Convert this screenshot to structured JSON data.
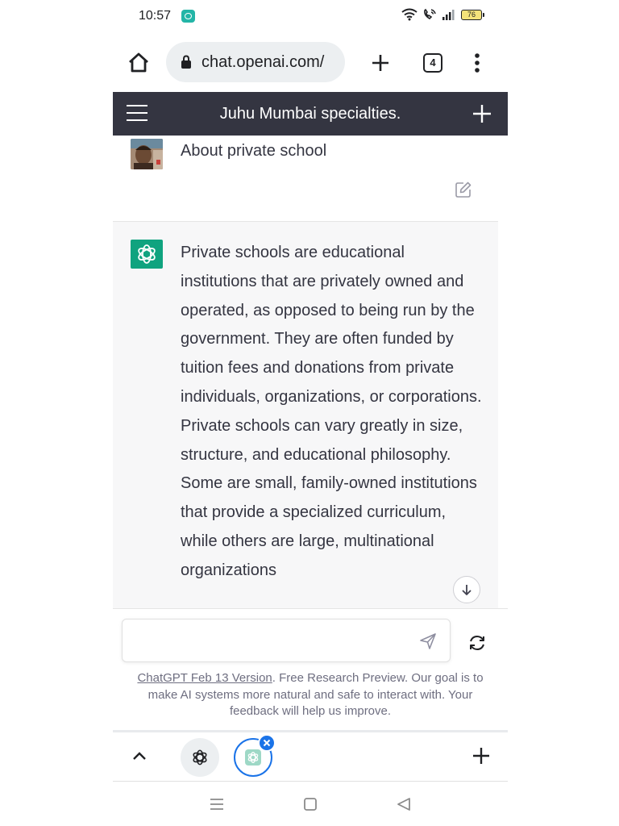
{
  "status_bar": {
    "time": "10:57",
    "battery": "76"
  },
  "browser": {
    "url": "chat.openai.com/",
    "tab_count": "4"
  },
  "chat": {
    "title": "Juhu Mumbai specialties.",
    "user_message": "About private school",
    "assistant_message": "Private schools are educational institutions that are privately owned and operated, as opposed to being run by the government. They are often funded by tuition fees and donations from private individuals, organizations, or corporations. Private schools can vary greatly in size, structure, and educational philosophy. Some are small, family-owned institutions that provide a specialized curriculum, while others are large, multinational organizations"
  },
  "composer": {
    "placeholder": "",
    "disclaimer_link": "ChatGPT Feb 13 Version",
    "disclaimer_text": ". Free Research Preview. Our goal is to make AI systems more natural and safe to interact with. Your feedback will help us improve."
  },
  "colors": {
    "header_bg": "#343541",
    "assistant_bg": "#f7f7f8",
    "brand_green": "#10a37f",
    "accent_blue": "#1a73e8"
  },
  "icons": {
    "home": "home-icon",
    "lock": "lock-icon",
    "new_tab": "plus-icon",
    "tabs": "tab-switcher-icon",
    "overflow": "more-vert-icon",
    "menu": "hamburger-menu-icon",
    "new_chat": "plus-icon",
    "edit": "edit-icon",
    "assistant": "openai-logo-icon",
    "scroll_down": "arrow-down-icon",
    "send": "send-icon",
    "regenerate": "refresh-icon",
    "chevron_up": "chevron-up-icon",
    "close": "close-icon"
  }
}
